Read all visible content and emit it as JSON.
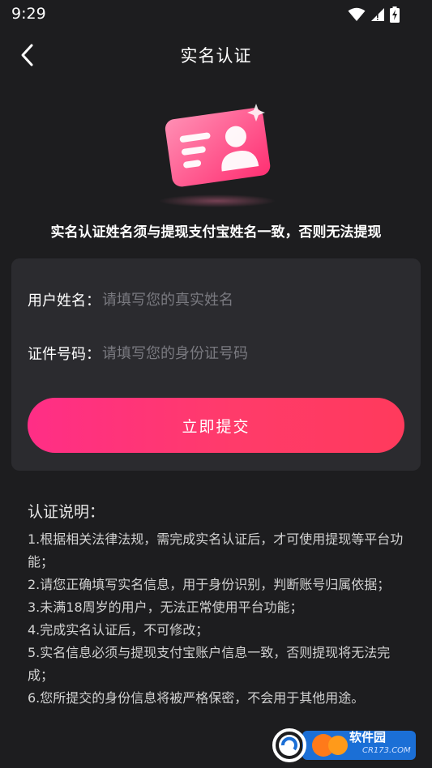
{
  "status_bar": {
    "time": "9:29",
    "icons": [
      "wifi-icon",
      "signal-icon",
      "battery-charging-icon"
    ]
  },
  "header": {
    "title": "实名认证",
    "back_icon": "chevron-left-icon"
  },
  "illustration": {
    "icon": "id-card-icon",
    "colors": [
      "#ff6b9a",
      "#ff3c7a"
    ]
  },
  "notice": "实名认证姓名须与提现支付宝姓名一致，否则无法提现",
  "form": {
    "name_label": "用户姓名：",
    "name_placeholder": "请填写您的真实姓名",
    "id_label": "证件号码：",
    "id_placeholder": "请填写您的身份证号码",
    "submit_label": "立即提交"
  },
  "instructions": {
    "title": "认证说明：",
    "items": [
      "1.根据相关法律法规，需完成实名认证后，才可使用提现等平台功能；",
      "2.请您正确填写实名信息，用于身份识别，判断账号归属依据；",
      "3.未满18周岁的用户，无法正常使用平台功能；",
      "4.完成实名认证后，不可修改；",
      "5.实名信息必须与提现支付宝账户信息一致，否则提现将无法完成；",
      "6.您所提交的身份信息将被严格保密，不会用于其他用途。"
    ]
  },
  "watermark": {
    "text": "软件园",
    "subtext": "CR173.COM"
  },
  "colors": {
    "background": "#1d1d1f",
    "card": "#2b2b2f",
    "accent_start": "#ff2e86",
    "accent_end": "#ff3a5c"
  }
}
